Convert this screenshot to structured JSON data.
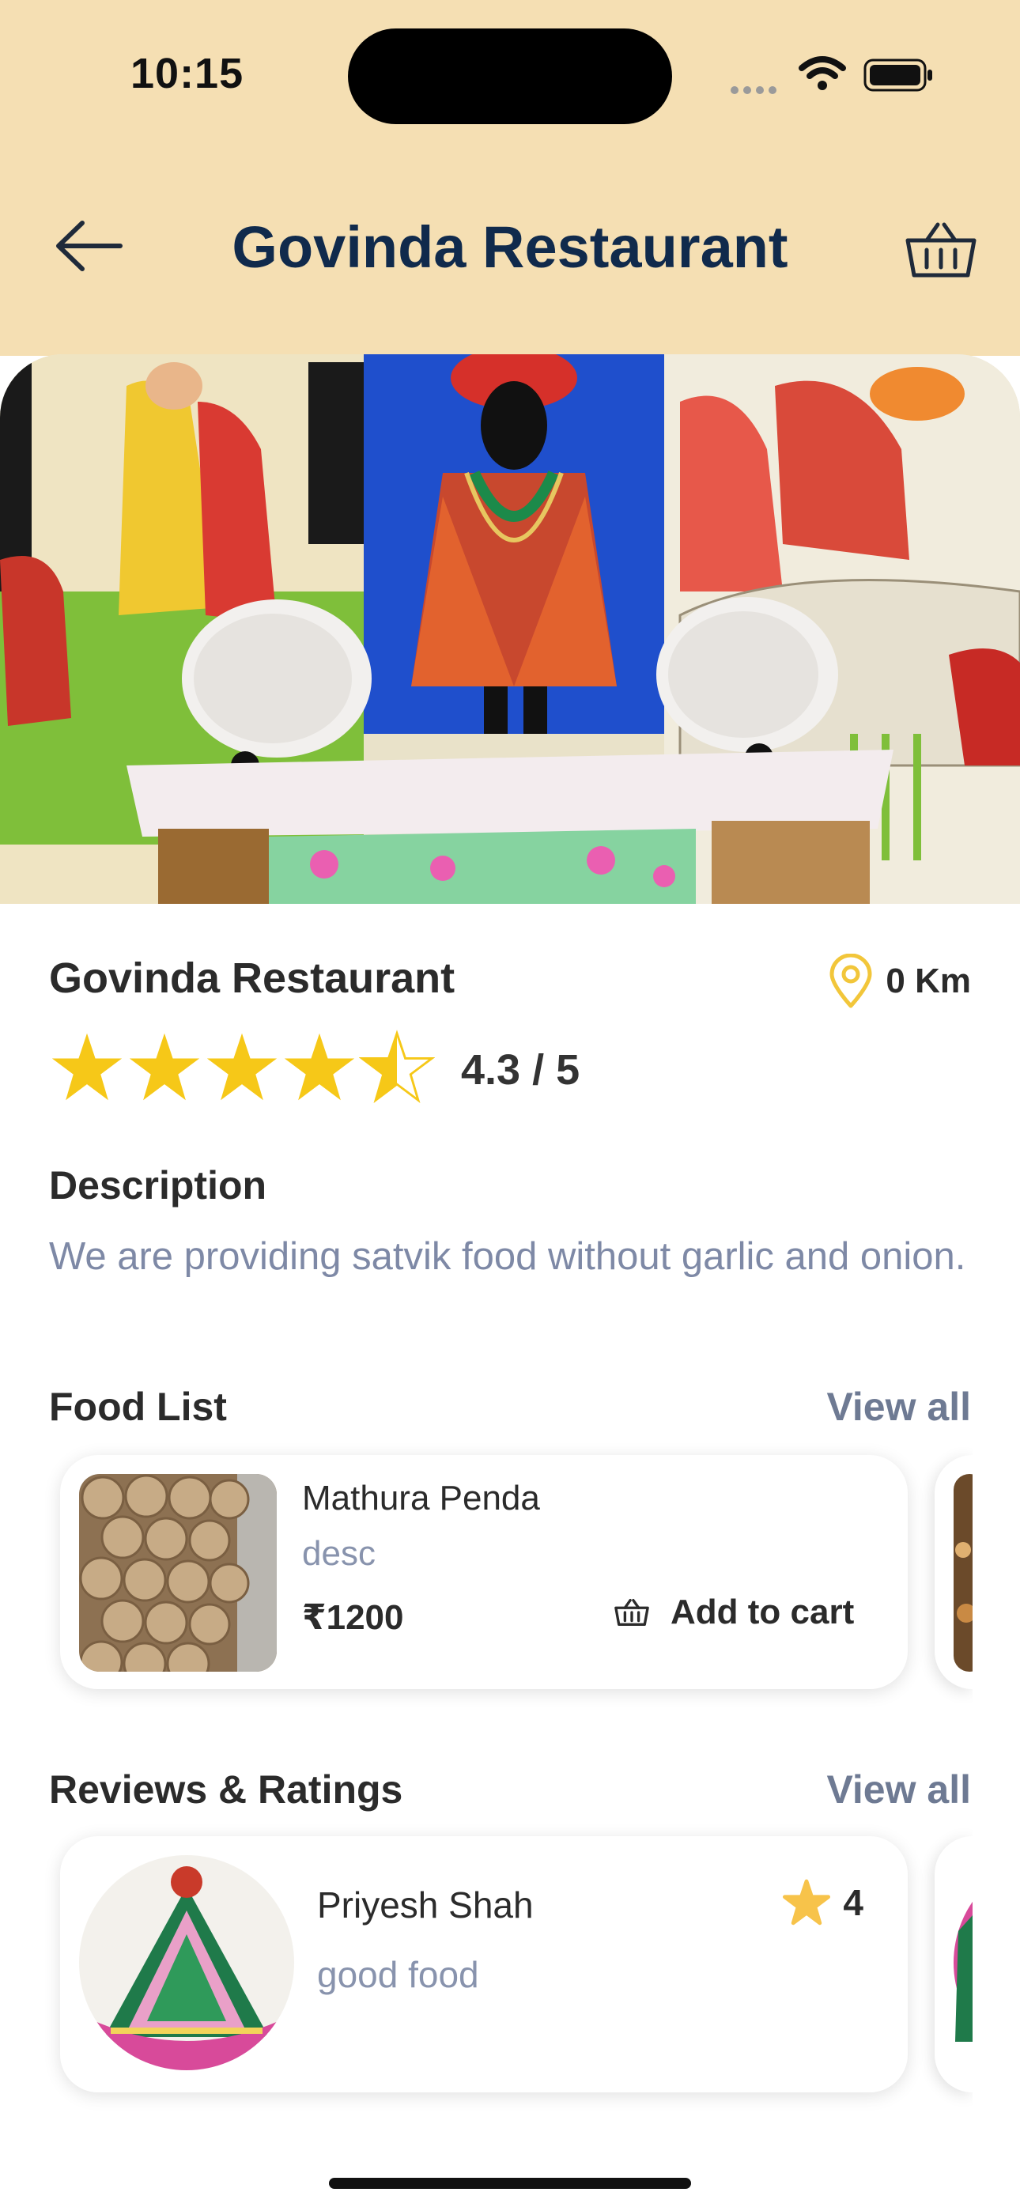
{
  "status_bar": {
    "time": "10:15"
  },
  "header": {
    "title": "Govinda Restaurant"
  },
  "restaurant": {
    "name": "Govinda Restaurant",
    "distance": "0 Km",
    "rating": 4.3,
    "rating_text": "4.3 / 5"
  },
  "description": {
    "heading": "Description",
    "text": "We are providing satvik food without garlic and onion."
  },
  "food_list": {
    "heading": "Food List",
    "view_all": "View all",
    "items": [
      {
        "name": "Mathura Penda",
        "desc": "desc",
        "price": "₹1200",
        "cta": "Add to cart"
      }
    ]
  },
  "reviews": {
    "heading": "Reviews & Ratings",
    "view_all": "View all",
    "items": [
      {
        "name": "Priyesh Shah",
        "text": "good food",
        "rating": "4"
      }
    ]
  },
  "colors": {
    "header_bg": "#f5dfb3",
    "title": "#102a4c",
    "star": "#f6c818",
    "muted": "#7e89a6"
  }
}
